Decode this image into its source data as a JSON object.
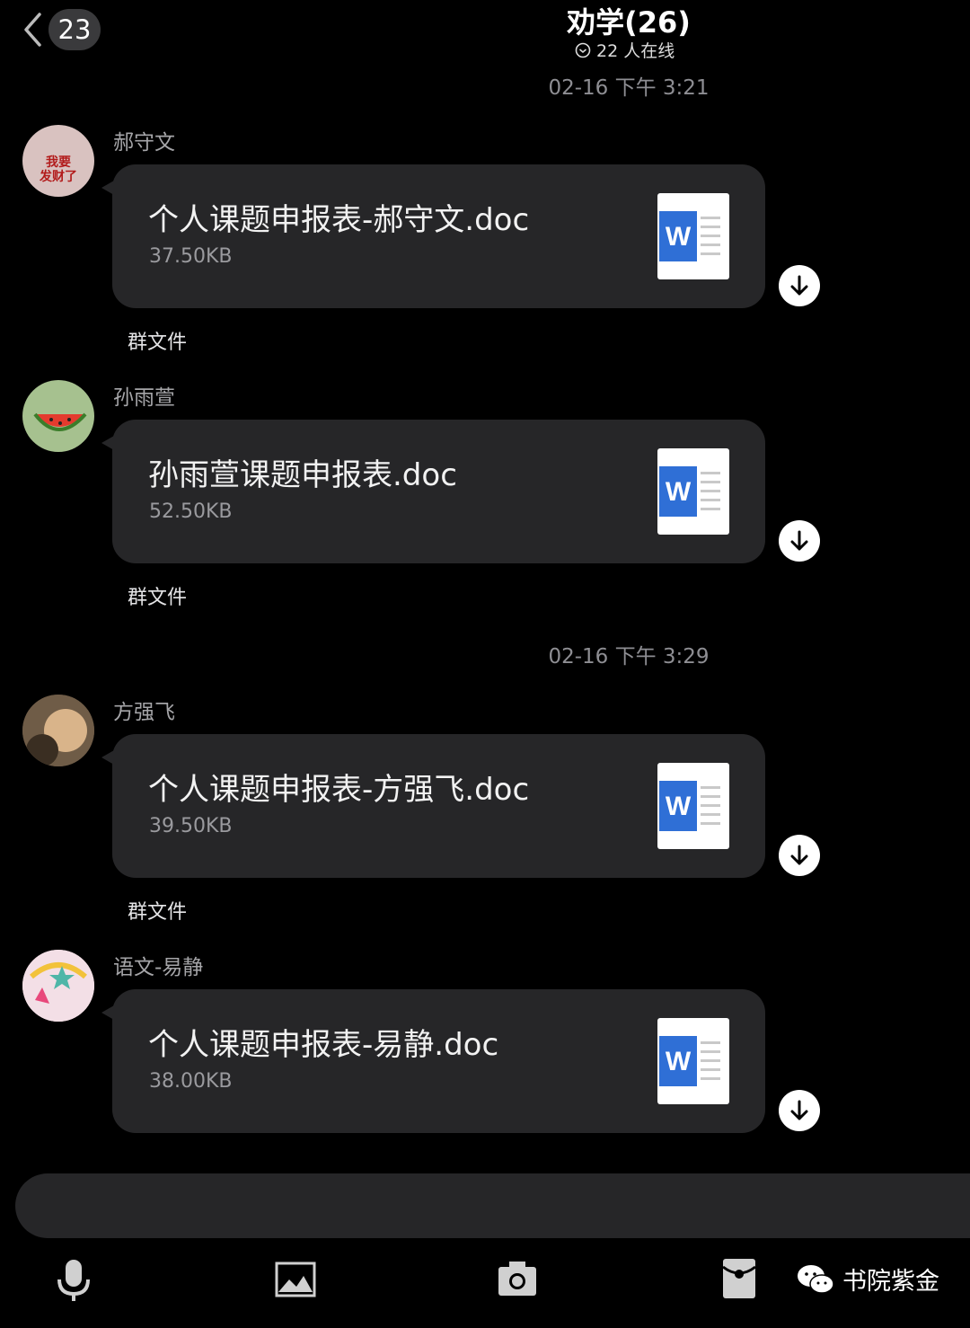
{
  "header": {
    "back_count": "23",
    "title": "劝学(26)",
    "online": "22 人在线"
  },
  "timestamps": [
    "02-16 下午 3:21",
    "02-16 下午 3:29"
  ],
  "messages": [
    {
      "sender": "郝守文",
      "file_name": "个人课题申报表-郝守文.doc",
      "file_size": "37.50KB",
      "tag": "群文件",
      "avatar_text": [
        "我要",
        "发财了"
      ]
    },
    {
      "sender": "孙雨萱",
      "file_name": "孙雨萱课题申报表.doc",
      "file_size": "52.50KB",
      "tag": "群文件"
    },
    {
      "sender": "方强飞",
      "file_name": "个人课题申报表-方强飞.doc",
      "file_size": "39.50KB",
      "tag": "群文件"
    },
    {
      "sender": "语文-易静",
      "file_name": "个人课题申报表-易静.doc",
      "file_size": "38.00KB"
    }
  ],
  "toolbar": {
    "icons": [
      "microphone-icon",
      "image-icon",
      "camera-icon",
      "red-packet-icon"
    ]
  },
  "watermark": "书院紫金",
  "colors": {
    "bubble": "#262628",
    "background": "#000000",
    "word_blue": "#2f6fd6"
  }
}
